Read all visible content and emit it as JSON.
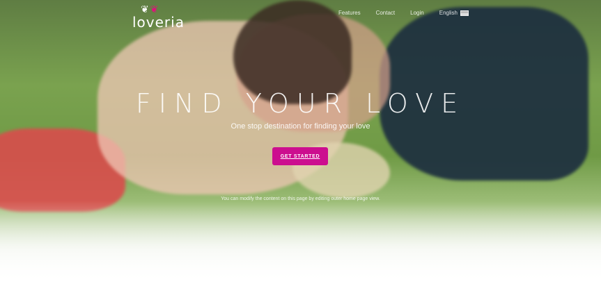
{
  "brand": {
    "name": "loveria",
    "icons": [
      "bird-white-icon",
      "bird-pink-icon"
    ]
  },
  "nav": {
    "items": [
      "Features",
      "Contact",
      "Login",
      "English"
    ],
    "language_icon": "flag-icon"
  },
  "hero": {
    "title": "FIND YOUR LOVE",
    "subtitle": "One stop destination for finding your love",
    "cta_label": "GET STARTED",
    "note": "You can modify the content on this page by editing outer home page view."
  },
  "colors": {
    "accent": "#cc0e8f",
    "text": "#ffffff"
  }
}
